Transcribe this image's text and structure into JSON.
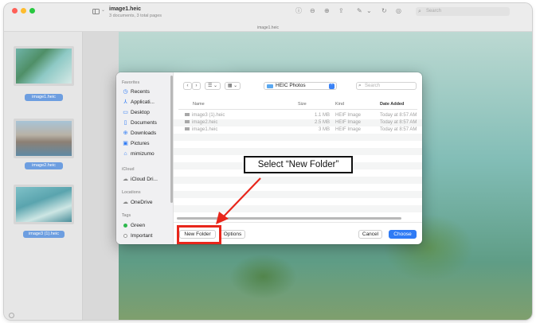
{
  "titlebar": {
    "doc_title": "image1.heic",
    "doc_subtitle": "3 documents, 3 total pages",
    "search_placeholder": "Search",
    "tab_label": "image1.heic"
  },
  "thumbnails": [
    {
      "label": "image1.heic"
    },
    {
      "label": "image2.heic"
    },
    {
      "label": "image3 (1).heic"
    }
  ],
  "dialog": {
    "sidebar": {
      "sections": {
        "favorites": "Favorites",
        "icloud": "iCloud",
        "locations": "Locations",
        "tags": "Tags"
      },
      "favorites": [
        {
          "label": "Recents",
          "icon": "clock-icon"
        },
        {
          "label": "Applicati...",
          "icon": "applications-icon"
        },
        {
          "label": "Desktop",
          "icon": "desktop-icon"
        },
        {
          "label": "Documents",
          "icon": "document-icon"
        },
        {
          "label": "Downloads",
          "icon": "download-icon"
        },
        {
          "label": "Pictures",
          "icon": "pictures-icon"
        },
        {
          "label": "mimizumo",
          "icon": "home-icon"
        }
      ],
      "icloud": [
        {
          "label": "iCloud Dri...",
          "icon": "cloud-icon"
        }
      ],
      "locations": [
        {
          "label": "OneDrive",
          "icon": "cloud-icon"
        }
      ],
      "tags": [
        {
          "label": "Green",
          "color": "#2db84d"
        },
        {
          "label": "Important",
          "color": "#ffffff"
        }
      ]
    },
    "toolbar": {
      "back": "‹",
      "forward": "›",
      "view_list": "☰ ⌄",
      "view_grid": "▦ ⌄",
      "folder": "HEIC Photos",
      "search_placeholder": "Search"
    },
    "table": {
      "columns": {
        "name": "Name",
        "size": "Size",
        "kind": "Kind",
        "date": "Date Added"
      },
      "rows": [
        {
          "name": "image3 (1).heic",
          "size": "1.1 MB",
          "kind": "HEIF Image",
          "date": "Today at 8:57 AM"
        },
        {
          "name": "image2.heic",
          "size": "2.5 MB",
          "kind": "HEIF Image",
          "date": "Today at 8:57 AM"
        },
        {
          "name": "image1.heic",
          "size": "3 MB",
          "kind": "HEIF Image",
          "date": "Today at 8:57 AM"
        }
      ]
    },
    "buttons": {
      "new_folder": "New Folder",
      "options": "Options",
      "cancel": "Cancel",
      "choose": "Choose"
    }
  },
  "annotation": {
    "callout": "Select “New Folder”",
    "highlight_color": "#e8261b"
  }
}
